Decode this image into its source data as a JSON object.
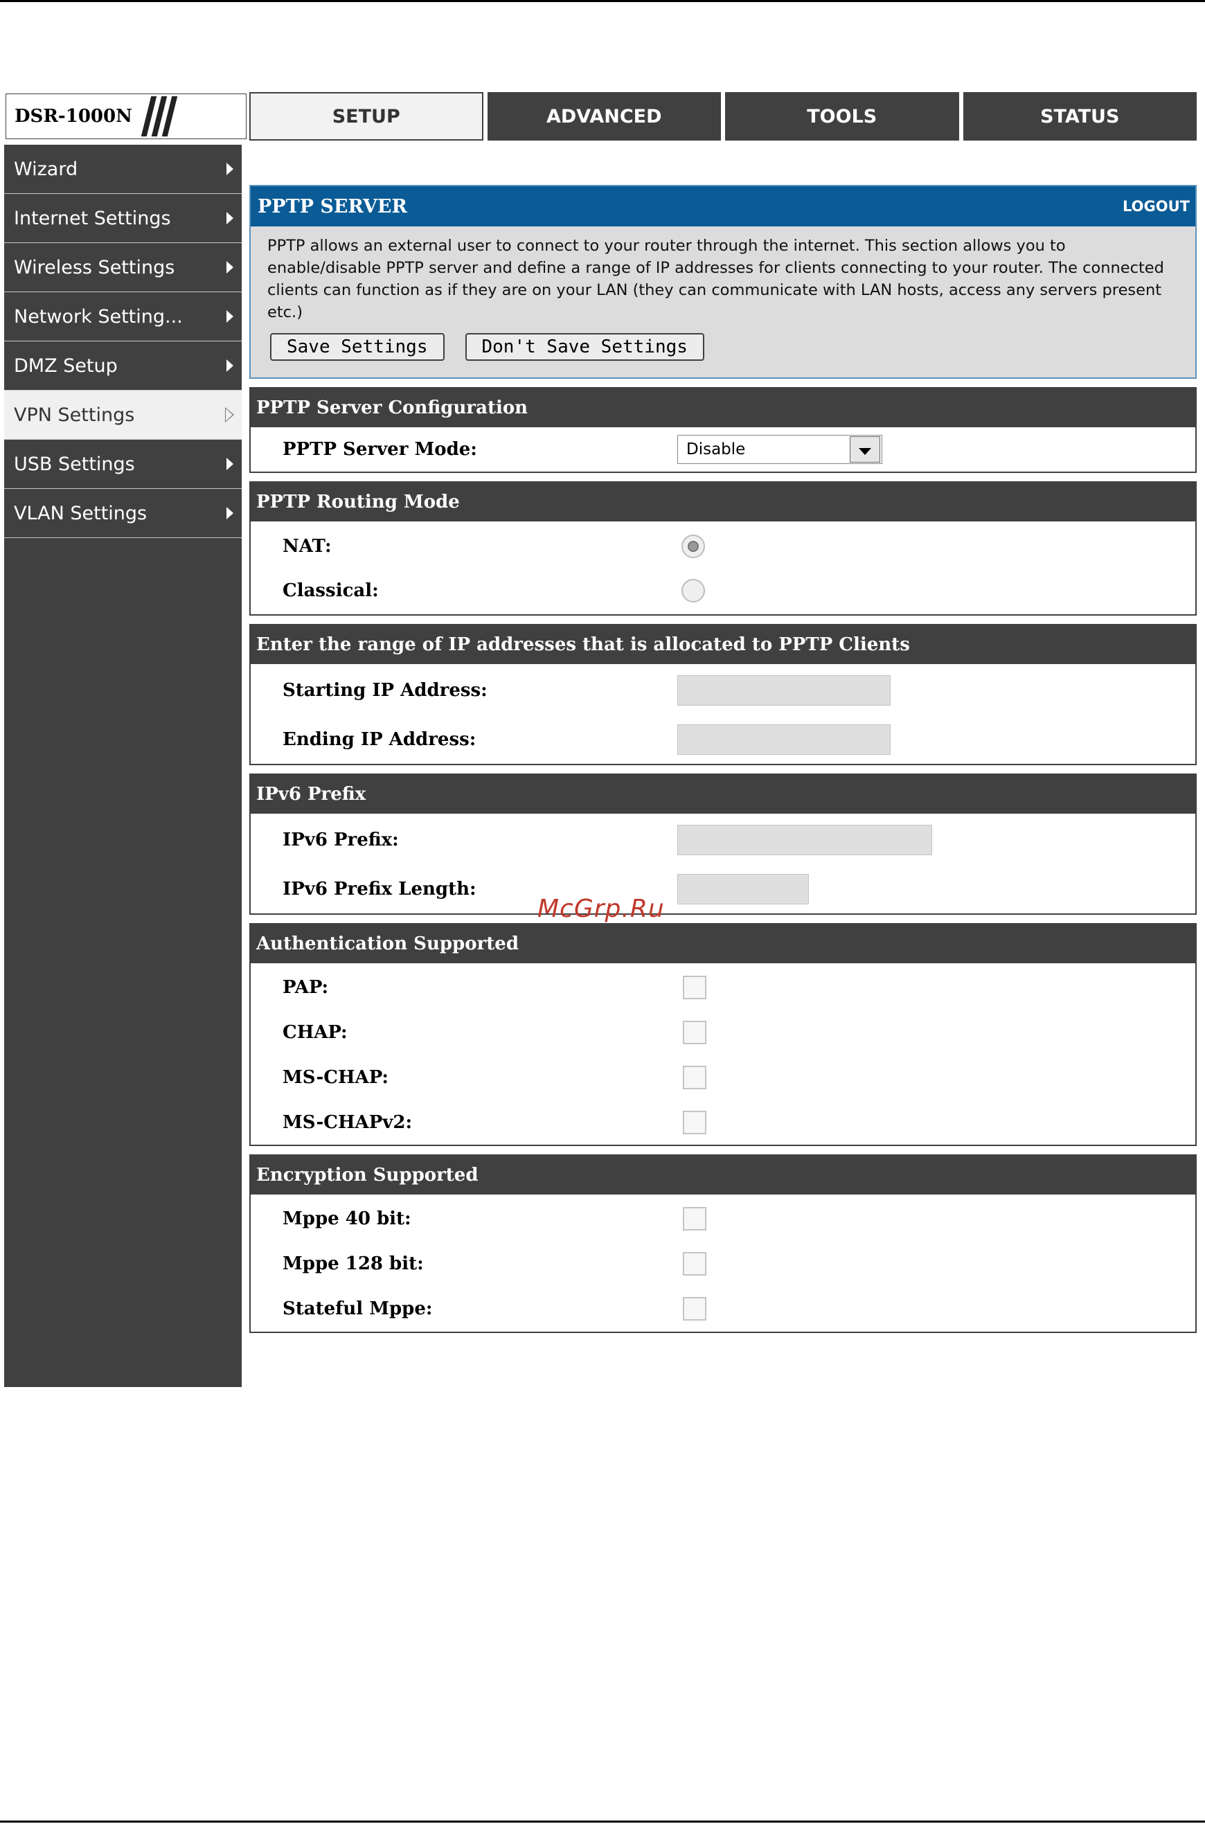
{
  "branding": {
    "model": "DSR-1000N"
  },
  "tabs": [
    {
      "label": "SETUP",
      "active": true
    },
    {
      "label": "ADVANCED",
      "active": false
    },
    {
      "label": "TOOLS",
      "active": false
    },
    {
      "label": "STATUS",
      "active": false
    }
  ],
  "sidebar": {
    "items": [
      {
        "label": "Wizard",
        "icon": "arrow-right-icon"
      },
      {
        "label": "Internet Settings",
        "icon": "arrow-right-icon"
      },
      {
        "label": "Wireless Settings",
        "icon": "arrow-right-icon"
      },
      {
        "label": "Network Setting...",
        "icon": "arrow-right-icon"
      },
      {
        "label": "DMZ Setup",
        "icon": "arrow-right-icon"
      },
      {
        "label": "VPN Settings",
        "icon": "arrow-right-outline-icon",
        "active": true
      },
      {
        "label": "USB Settings",
        "icon": "arrow-right-icon"
      },
      {
        "label": "VLAN Settings",
        "icon": "arrow-right-icon"
      }
    ]
  },
  "pptp": {
    "title": "PPTP SERVER",
    "logout": "LOGOUT",
    "description": "PPTP allows an external user to connect to your router through the internet. This section allows you to enable/disable PPTP server and define a range of IP addresses for clients connecting to your router. The connected clients can function as if they are on your LAN (they can communicate with LAN hosts, access any servers present etc.)",
    "save_label": "Save Settings",
    "dont_save_label": "Don't Save Settings"
  },
  "server_config": {
    "title": "PPTP Server Configuration",
    "mode_label": "PPTP Server Mode:",
    "mode_value": "Disable"
  },
  "routing": {
    "title": "PPTP Routing Mode",
    "nat_label": "NAT:",
    "nat_selected": true,
    "classical_label": "Classical:",
    "classical_selected": false
  },
  "ip_range": {
    "title": "Enter the range of IP addresses that is allocated to PPTP Clients",
    "start_label": "Starting IP Address:",
    "start_value": "",
    "end_label": "Ending IP Address:",
    "end_value": ""
  },
  "ipv6": {
    "title": "IPv6 Prefix",
    "prefix_label": "IPv6 Prefix:",
    "prefix_value": "",
    "length_label": "IPv6 Prefix Length:",
    "length_value": ""
  },
  "auth": {
    "title": "Authentication Supported",
    "options": [
      {
        "label": "PAP:",
        "checked": false
      },
      {
        "label": "CHAP:",
        "checked": false
      },
      {
        "label": "MS-CHAP:",
        "checked": false
      },
      {
        "label": "MS-CHAPv2:",
        "checked": false
      }
    ]
  },
  "encryption": {
    "title": "Encryption Supported",
    "options": [
      {
        "label": "Mppe 40 bit:",
        "checked": false
      },
      {
        "label": "Mppe 128 bit:",
        "checked": false
      },
      {
        "label": "Stateful Mppe:",
        "checked": false
      }
    ]
  },
  "watermark": "McGrp.Ru",
  "colors": {
    "header_blue": "#0a5b96",
    "dark_gray": "#404040",
    "watermark_red": "#c0392b"
  }
}
